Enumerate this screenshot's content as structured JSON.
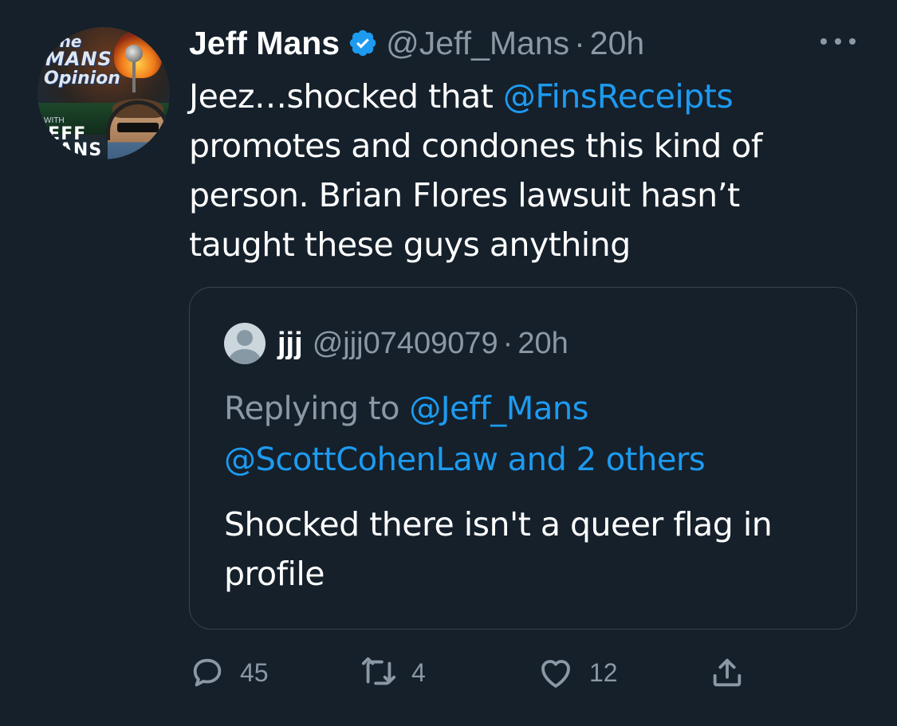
{
  "tweet": {
    "author": {
      "display_name": "Jeff Mans",
      "handle": "@Jeff_Mans",
      "verified": true,
      "avatar_text": {
        "line1": "The",
        "line2": "MANS",
        "line3": "Opinion",
        "with": "WITH",
        "name1": "JEFF",
        "name2": "MANS"
      }
    },
    "separator": "·",
    "time": "20h",
    "text_parts": {
      "before_mention": "Jeez…shocked that ",
      "mention": "@FinsReceipts",
      "after_mention": " promotes and condones this kind of person. Brian Flores lawsuit hasn’t taught these guys anything"
    },
    "more_icon": "more-horizontal-icon"
  },
  "quote": {
    "author": {
      "display_name": "jjj",
      "handle": "@jjj07409079"
    },
    "separator": "·",
    "time": "20h",
    "replying_prefix": "Replying to ",
    "replying_mention": "@Jeff_Mans",
    "replying_line2_mention": "@ScottCohenLaw",
    "replying_and": " and ",
    "replying_others": "2 others",
    "text": "Shocked there isn't a queer flag in profile"
  },
  "actions": {
    "reply": {
      "icon": "reply-icon",
      "count": "45"
    },
    "retweet": {
      "icon": "retweet-icon",
      "count": "4"
    },
    "like": {
      "icon": "heart-icon",
      "count": "12"
    },
    "share": {
      "icon": "share-icon",
      "count": ""
    }
  },
  "colors": {
    "background": "#15202b",
    "text_primary": "#ffffff",
    "text_secondary": "#8b98a5",
    "accent": "#1d9bf0",
    "border": "#38444d"
  }
}
